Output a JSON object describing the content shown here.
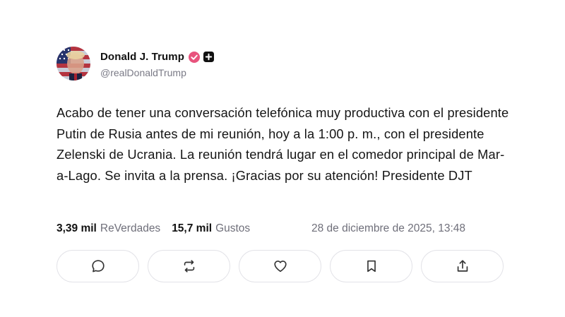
{
  "author": {
    "display_name": "Donald J. Trump",
    "handle": "@realDonaldTrump",
    "avatar_icon": "flag-portrait-avatar",
    "badges": [
      "verified-check-icon",
      "plus-badge-icon"
    ]
  },
  "post": {
    "text": "Acabo de tener una conversación telefónica muy productiva con el presidente Putin de Rusia antes de mi reunión, hoy a la 1:00 p. m., con el presidente Zelenski de Ucrania. La reunión tendrá lugar en el comedor principal de Mar-a-Lago. Se invita a la prensa. ¡Gracias por su atención! Presidente DJT"
  },
  "stats": {
    "reposts_count": "3,39 mil",
    "reposts_label": "ReVerdades",
    "likes_count": "15,7 mil",
    "likes_label": "Gustos",
    "timestamp": "28 de diciembre de 2025, 13:48"
  },
  "actions": [
    {
      "name": "reply",
      "icon": "comment-icon"
    },
    {
      "name": "repost",
      "icon": "repost-icon"
    },
    {
      "name": "like",
      "icon": "heart-icon"
    },
    {
      "name": "bookmark",
      "icon": "bookmark-icon"
    },
    {
      "name": "share",
      "icon": "share-icon"
    }
  ],
  "colors": {
    "text": "#151515",
    "muted": "#6f6f7a",
    "border": "#e3e3e8",
    "verified": "#e8537d",
    "icon": "#333333"
  }
}
